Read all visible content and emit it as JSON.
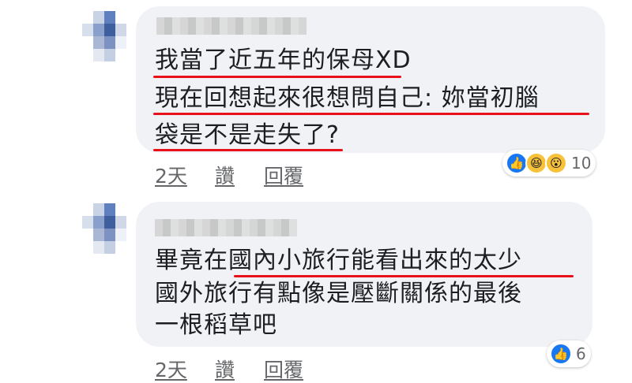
{
  "comments": [
    {
      "lines": [
        "我當了近五年的保母XD",
        "現在回想起來很想問自己: 妳當初腦",
        "袋是不是走失了?"
      ],
      "time": "2天",
      "like_label": "讚",
      "reply_label": "回覆",
      "reactions": [
        "like-icon",
        "haha-icon",
        "wow-icon"
      ],
      "reaction_count": "10"
    },
    {
      "lines": [
        "畢竟在國內小旅行能看出來的太少",
        "國外旅行有點像是壓斷關係的最後",
        "一根稻草吧"
      ],
      "time": "2天",
      "like_label": "讚",
      "reply_label": "回覆",
      "reactions": [
        "like-icon"
      ],
      "reaction_count": "6"
    }
  ],
  "colors": {
    "bubble": "#f0f2f5",
    "underline": "#e8101a",
    "like_blue": "#1877f2",
    "meta_gray": "#65676b"
  }
}
